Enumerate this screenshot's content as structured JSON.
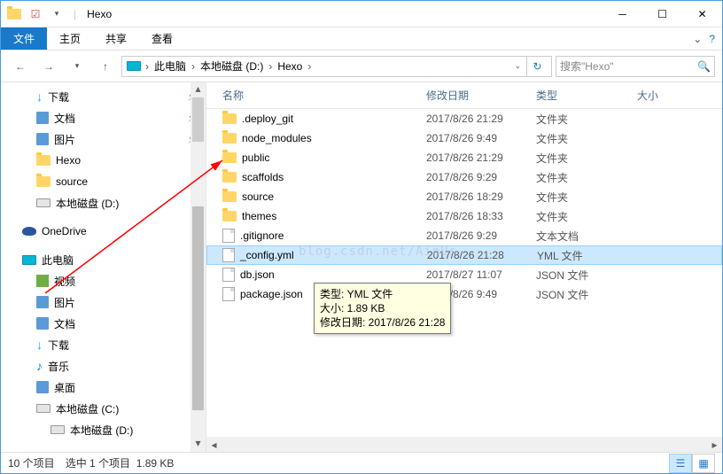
{
  "title": "Hexo",
  "ribbon": {
    "file": "文件",
    "home": "主页",
    "share": "共享",
    "view": "查看"
  },
  "nav": {
    "back": "←",
    "fwd": "→",
    "up": "↑"
  },
  "breadcrumb": {
    "root": "此电脑",
    "drive": "本地磁盘 (D:)",
    "folder": "Hexo"
  },
  "search": {
    "placeholder": "搜索\"Hexo\""
  },
  "tree": {
    "downloads": "下载",
    "documents": "文档",
    "pictures": "图片",
    "hexo": "Hexo",
    "source": "source",
    "localdisk_d": "本地磁盘 (D:)",
    "onedrive": "OneDrive",
    "thispc": "此电脑",
    "videos": "视频",
    "music": "音乐",
    "desktop": "桌面",
    "localdisk_c": "本地磁盘 (C:)"
  },
  "columns": {
    "name": "名称",
    "date": "修改日期",
    "type": "类型",
    "size": "大小"
  },
  "files": [
    {
      "name": ".deploy_git",
      "date": "2017/8/26 21:29",
      "type": "文件夹",
      "kind": "folder"
    },
    {
      "name": "node_modules",
      "date": "2017/8/26 9:49",
      "type": "文件夹",
      "kind": "folder"
    },
    {
      "name": "public",
      "date": "2017/8/26 21:29",
      "type": "文件夹",
      "kind": "folder"
    },
    {
      "name": "scaffolds",
      "date": "2017/8/26 9:29",
      "type": "文件夹",
      "kind": "folder"
    },
    {
      "name": "source",
      "date": "2017/8/26 18:29",
      "type": "文件夹",
      "kind": "folder"
    },
    {
      "name": "themes",
      "date": "2017/8/26 18:33",
      "type": "文件夹",
      "kind": "folder"
    },
    {
      "name": ".gitignore",
      "date": "2017/8/26 9:29",
      "type": "文本文档",
      "kind": "file"
    },
    {
      "name": "_config.yml",
      "date": "2017/8/26 21:28",
      "type": "YML 文件",
      "kind": "file",
      "selected": true
    },
    {
      "name": "db.json",
      "date": "2017/8/27 11:07",
      "type": "JSON 文件",
      "kind": "file"
    },
    {
      "name": "package.json",
      "date": "2017/8/26 9:49",
      "type": "JSON 文件",
      "kind": "file"
    }
  ],
  "tooltip": {
    "l1": "类型: YML 文件",
    "l2": "大小: 1.89 KB",
    "l3": "修改日期: 2017/8/26 21:28"
  },
  "status": {
    "count": "10 个项目",
    "selected": "选中 1 个项目",
    "size": "1.89 KB"
  },
  "watermark": "blog.csdn.net/AinUs"
}
